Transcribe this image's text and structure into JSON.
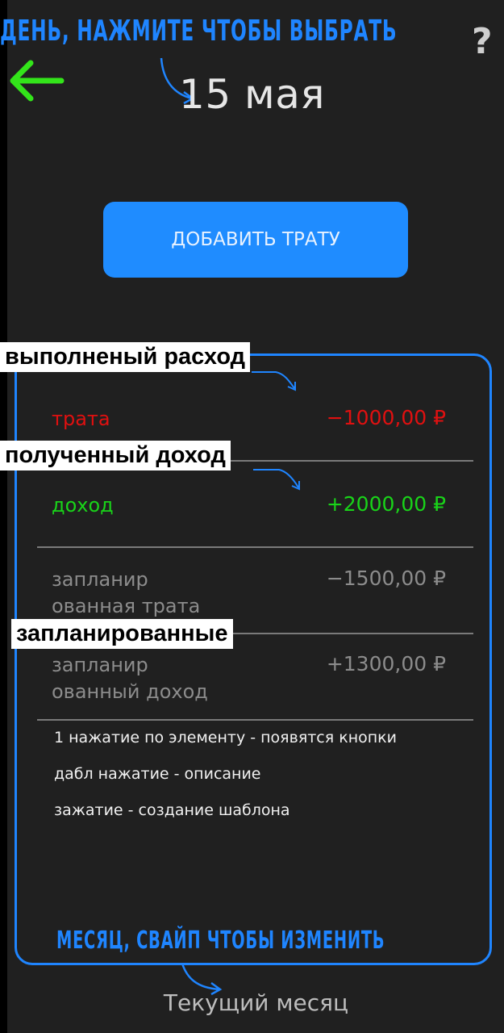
{
  "header": {
    "date": "15 мая",
    "help": "?",
    "back_icon": "back-arrow-icon",
    "back_color": "#33e41a"
  },
  "hints": {
    "day": "ДЕНЬ, НАЖМИТЕ ЧТОБЫ ВЫБРАТЬ",
    "month": "МЕСЯЦ, СВАЙП ЧТОБЫ ИЗМЕНИТЬ"
  },
  "add_button": {
    "label": "ДОБАВИТЬ ТРАТУ",
    "color": "#1f8cff"
  },
  "entries": [
    {
      "label": "трата",
      "amount": "−1000,00 ₽",
      "color": "#e01010"
    },
    {
      "label": "доход",
      "amount": "+2000,00 ₽",
      "color": "#19d419"
    },
    {
      "label_line1": "запланир",
      "label_line2": "ованная трата",
      "amount": "−1500,00 ₽",
      "color": "#8c8c8c"
    },
    {
      "label_line1": "запланир",
      "label_line2": "ованный доход",
      "amount": "+1300,00 ₽",
      "color": "#8c8c8c"
    }
  ],
  "tags": {
    "done_expense": "выполненый расход",
    "received_income": "полученный доход",
    "planned": "запланированные"
  },
  "tips": [
    "1 нажатие по элементу - появятся кнопки",
    "дабл нажатие - описание",
    "зажатие - создание шаблона"
  ],
  "footer": {
    "month": "Текущий месяц"
  },
  "accent_color": "#1f85ff"
}
